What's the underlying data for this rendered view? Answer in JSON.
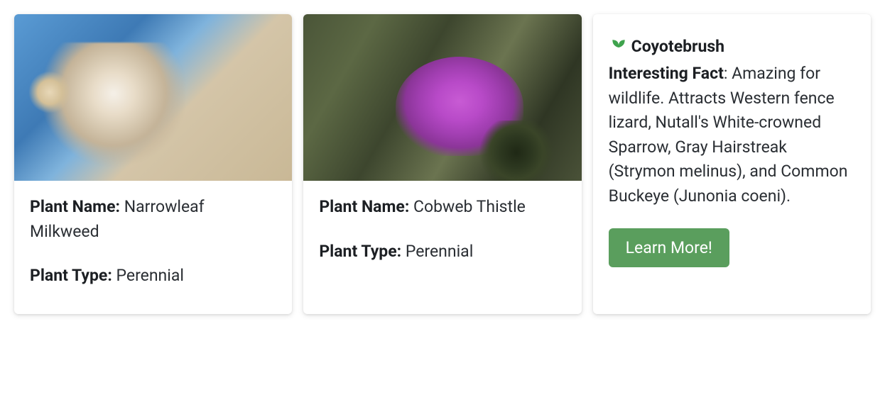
{
  "labels": {
    "plant_name": "Plant Name:",
    "plant_type": "Plant Type:",
    "interesting_fact": "Interesting Fact",
    "learn_more": "Learn More!"
  },
  "cards": [
    {
      "name": "Narrowleaf Milkweed",
      "type": "Perennial"
    },
    {
      "name": "Cobweb Thistle",
      "type": "Perennial"
    },
    {
      "name": "Coyotebrush",
      "fact": ": Amazing for wildlife. Attracts Western fence lizard, Nutall's White-crowned Sparrow, Gray Hairstreak (Strymon melinus), and Common Buckeye (Junonia coeni)."
    }
  ]
}
